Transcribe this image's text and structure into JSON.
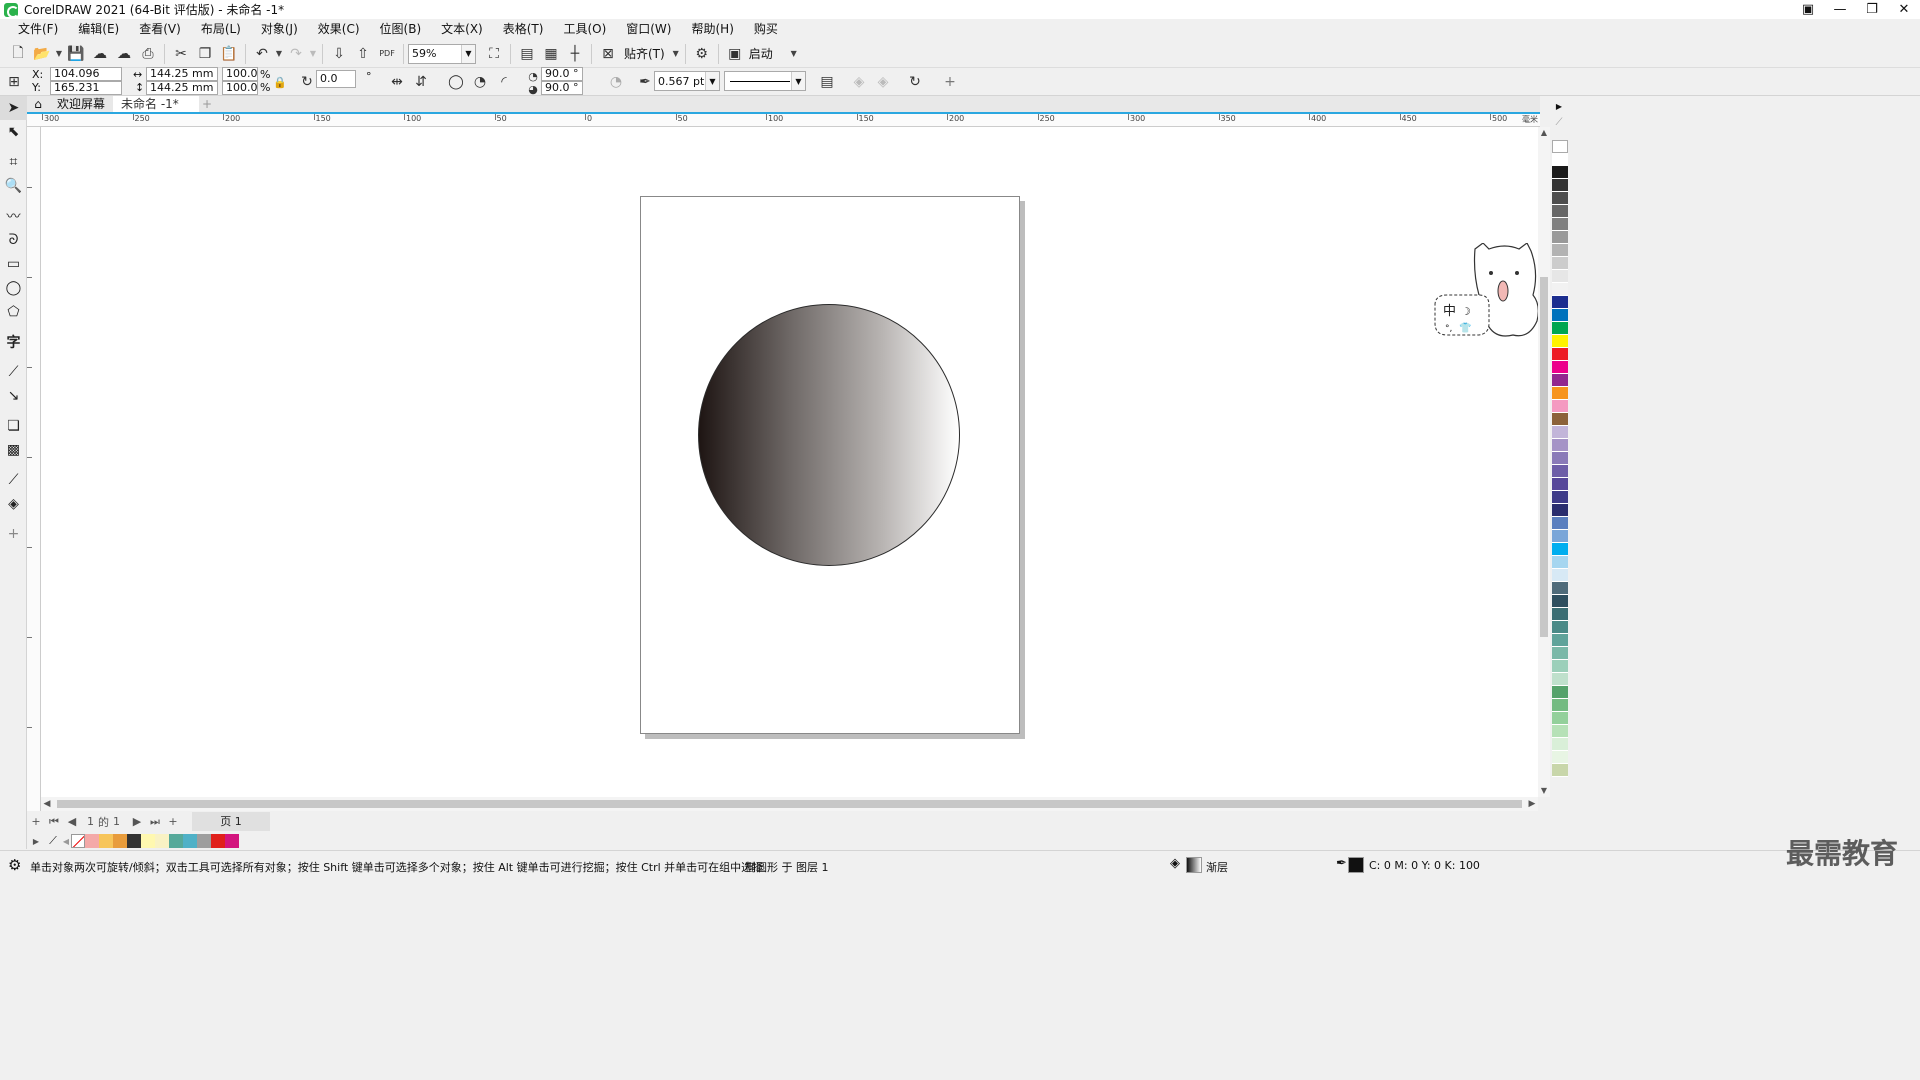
{
  "window": {
    "title": "CorelDRAW 2021 (64-Bit 评估版) - 未命名 -1*",
    "controls": [
      "▣",
      "—",
      "❐",
      "✕"
    ]
  },
  "menu": [
    "文件(F)",
    "编辑(E)",
    "查看(V)",
    "布局(L)",
    "对象(J)",
    "效果(C)",
    "位图(B)",
    "文本(X)",
    "表格(T)",
    "工具(O)",
    "窗口(W)",
    "帮助(H)",
    "购买"
  ],
  "toolbar": {
    "zoom": "59%",
    "snap_label": "贴齐(T)",
    "launch_label": "启动"
  },
  "propbar": {
    "x_label": "X:",
    "y_label": "Y:",
    "x_value": "104.096 mm",
    "y_value": "165.231 mm",
    "width": "144.25 mm",
    "height": "144.25 mm",
    "scale_w": "100.0",
    "scale_h": "100.0",
    "percent": "%",
    "rotation": "0.0",
    "degree": "°",
    "start_angle": "90.0 °",
    "end_angle": "90.0 °",
    "outline_width": "0.567 pt"
  },
  "tabs": {
    "welcome": "欢迎屏幕",
    "document": "未命名 -1*"
  },
  "ruler": {
    "h_labels": [
      "300",
      "250",
      "200",
      "150",
      "100",
      "50",
      "0",
      "50",
      "100",
      "150",
      "200",
      "250",
      "300",
      "350",
      "400",
      "450",
      "500"
    ],
    "units": "毫米"
  },
  "pagenav": {
    "current": "1",
    "of": "的",
    "total": "1",
    "page_tab": "页 1"
  },
  "status": {
    "hint": "单击对象两次可旋转/倾斜；双击工具可选择所有对象；按住 Shift 键单击可选择多个对象；按住 Alt 键单击可进行挖掘；按住 Ctrl 并单击可在组中选择",
    "object_info": "椭圆形 于 图层 1",
    "fill_type": "渐层",
    "outline_color": "C: 0 M: 0 Y: 0 K: 100"
  },
  "watermark": "最需教育",
  "mascot_ime": "中",
  "colors": {
    "accent": "#2aa7e0",
    "gradient_start": "#1e1513",
    "gradient_end": "#ffffff"
  },
  "palette": [
    "#ffffff",
    "#1a1a1a",
    "#333333",
    "#4d4d4d",
    "#666666",
    "#808080",
    "#999999",
    "#b3b3b3",
    "#cccccc",
    "#e6e6e6",
    "#f2f2f2",
    "#1c2e8f",
    "#0072bc",
    "#00a651",
    "#fff200",
    "#ed1c24",
    "#ec008c",
    "#92278f",
    "#f7941d",
    "#f49ac1",
    "#8c6239",
    "#c2b5d9",
    "#a593c6",
    "#8a7ab8",
    "#6e5ea8",
    "#57479a",
    "#3e3a88",
    "#2a2d6e",
    "#5a7fbf",
    "#7aa6d8",
    "#00aeef",
    "#a6d6f0",
    "#d7e9f5",
    "#4f6b7a",
    "#2f4f5f",
    "#3c6e74",
    "#4a8a87",
    "#5fa39a",
    "#7ab8a8",
    "#9ccfba",
    "#bfe0cc",
    "#55a26b",
    "#74bb82",
    "#93d09b",
    "#b6e1b7",
    "#d9efd8",
    "#e8f5e4",
    "#c8d6aa"
  ],
  "doc_palette": [
    "#f4a9a8",
    "#f7c55a",
    "#e89c3c",
    "#333333",
    "#fff8b0",
    "#f9f2c4",
    "#56a99a",
    "#4fb1c7",
    "#9e9e9e",
    "#e0201b",
    "#d3147e"
  ]
}
